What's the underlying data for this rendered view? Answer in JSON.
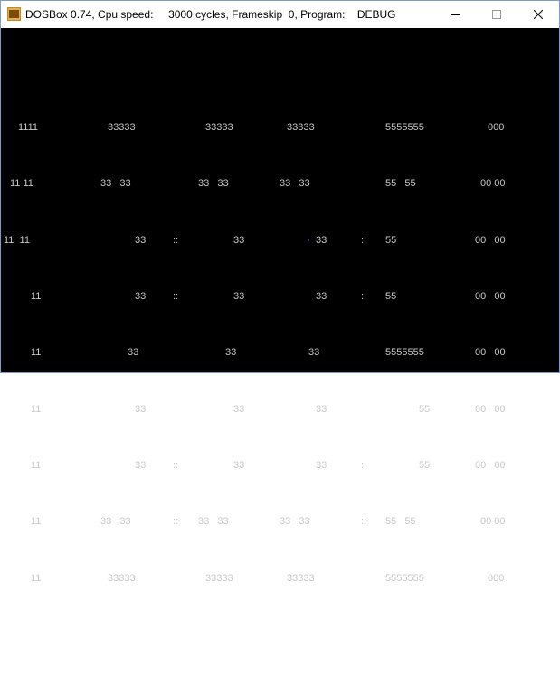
{
  "window": {
    "title": "DOSBox 0.74, Cpu speed:     3000 cycles, Frameskip  0, Program:    DEBUG",
    "icon": "dosbox-icon",
    "controls": {
      "minimize_icon": "minimize-icon",
      "maximize_icon": "maximize-icon",
      "close_icon": "close-icon"
    }
  },
  "console": {
    "rows": [
      [
        "1111",
        "33333",
        "33333",
        "33333",
        "5555555",
        "000"
      ],
      [
        "11 11",
        "33   33",
        "33   33",
        "33   33",
        "55   55",
        "00 00"
      ],
      [
        "11  11",
        "33",
        "::",
        "33",
        "33",
        "::",
        "55",
        "00   00"
      ],
      [
        "11",
        "33",
        "::",
        "33",
        "33",
        "::",
        "55",
        "00   00"
      ],
      [
        "11",
        "33",
        "33",
        "33",
        "5555555",
        "00   00"
      ],
      [
        "11",
        "33",
        "33",
        "33",
        "55",
        "00   00"
      ],
      [
        "11",
        "33",
        "::",
        "33",
        "33",
        "::",
        "55",
        "00   00"
      ],
      [
        "11",
        "33   33",
        "::",
        "33   33",
        "33   33",
        "::",
        "55   55",
        "00 00"
      ],
      [
        "11",
        "33333",
        "33333",
        "33333",
        "5555555",
        "000"
      ]
    ]
  },
  "colors": {
    "screen_bg": "#000000",
    "text": "#c8c8c8",
    "titlebar_bg": "#ffffff",
    "border": "#7a9ccf"
  }
}
